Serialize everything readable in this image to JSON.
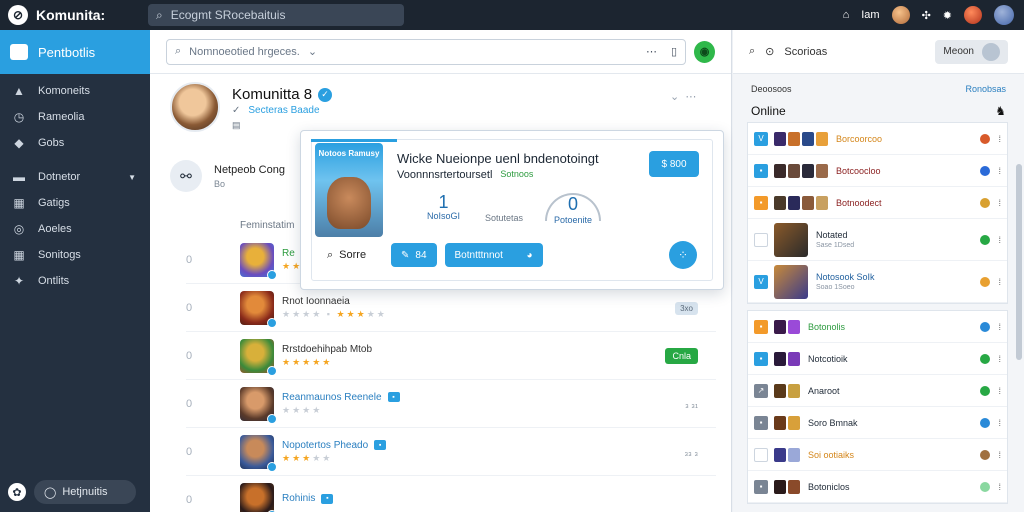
{
  "topbar": {
    "brand": "Komunita:",
    "search_placeholder": "Ecogmt SRocebaituis",
    "user_label": "Iam"
  },
  "leftnav": {
    "active": "Pentbotlis",
    "items": [
      {
        "icon": "person-icon",
        "glyph": "▲",
        "label": "Komoneits"
      },
      {
        "icon": "clock-icon",
        "glyph": "◷",
        "label": "Rameolia"
      },
      {
        "icon": "tag-icon",
        "glyph": "◆",
        "label": "Gobs"
      }
    ],
    "items2": [
      {
        "icon": "menu-icon",
        "glyph": "▬",
        "label": "Dotnetor",
        "caret": true
      },
      {
        "icon": "calendar-icon",
        "glyph": "▦",
        "label": "Gatigs"
      },
      {
        "icon": "bubble-icon",
        "glyph": "◎",
        "label": "Aoeles"
      },
      {
        "icon": "grid-icon",
        "glyph": "▦",
        "label": "Sonitogs"
      },
      {
        "icon": "pin-icon",
        "glyph": "✦",
        "label": "Ontlits"
      }
    ],
    "bottom_search": "Hetjnuitis"
  },
  "main": {
    "search_placeholder": "Nomnoeotied hrgeces.",
    "profile": {
      "name": "Komunitta 8",
      "sub_blue": "Secteras Baade",
      "sub_meta": "▤"
    },
    "sub_header": {
      "title": "Netpeob Cong",
      "sub": "Bo"
    },
    "section_label": "Feminstatim",
    "rows": [
      {
        "idx": "0",
        "title": "Re",
        "title_color": "green",
        "stars_on": 3,
        "stars_off": 2,
        "right": "",
        "right_type": "none",
        "colors": [
          "#6a4cbf",
          "#e8b03a",
          "#3e7bd8"
        ]
      },
      {
        "idx": "0",
        "title": "Rnot Ioonnaeia",
        "title_color": "dark",
        "stars_on": 0,
        "stars_off": 4,
        "extra_stars_on": 3,
        "right": "3xo",
        "right_type": "gray",
        "colors": [
          "#8a2a1a",
          "#e28a3a",
          "#3a1a10"
        ]
      },
      {
        "idx": "0",
        "title": "Rrstdoehihpab Mtob",
        "title_color": "dark",
        "stars_on": 5,
        "stars_off": 0,
        "right": "Cnla",
        "right_type": "green",
        "colors": [
          "#3a8a3a",
          "#d8b03a",
          "#b5472a"
        ]
      },
      {
        "idx": "0",
        "title": "Reanmaunos Reenele",
        "title_color": "blue",
        "stars_on": 0,
        "stars_off": 4,
        "right": "₃ ₃₁",
        "right_type": "text",
        "colors": [
          "#5a3a2a",
          "#d89a6a",
          "#2a2a3a"
        ]
      },
      {
        "idx": "0",
        "title": "Nopotertos Pheado",
        "title_color": "blue",
        "stars_on": 3,
        "stars_off": 2,
        "right": "₃₃ ₃",
        "right_type": "text",
        "colors": [
          "#3a5a9a",
          "#c88a5a",
          "#1a2a4a"
        ]
      },
      {
        "idx": "0",
        "title": "Rohinis",
        "title_color": "blue",
        "stars_on": 0,
        "stars_off": 0,
        "right": "",
        "right_type": "none",
        "colors": [
          "#2a1a1a",
          "#c8702a",
          "#5a3a1a"
        ]
      }
    ]
  },
  "popup": {
    "card_label": "Notoos Ramusy",
    "title": "Wicke Nueionpe uenl bndenotoingt",
    "subtitle": "Voonnnsrtertoursetl",
    "subtitle_green": "Sotnoos",
    "price_btn": "$ 800",
    "stat1_num": "1",
    "stat1_lbl": "NoIsoGI",
    "stat1_lbl2": "Sotutetas",
    "stat2_num": "0",
    "stat2_lbl": "Potoenite",
    "search_label": "Sorre",
    "btn1": "84",
    "btn2": "Botntttnnot",
    "fab": "⁘"
  },
  "right": {
    "top_label": "Scorioas",
    "top_btn": "Meoon",
    "section_left": "Deoosoos",
    "section_right": "Ronobsas",
    "online_label": "Online",
    "rows": [
      {
        "sq": "blue",
        "sq_glyph": "V",
        "kind": "thumbs",
        "name": "Borcoorcoo",
        "name_color": "orange",
        "thumbs": [
          "#3a2a6a",
          "#c8702a",
          "#2a4a8a",
          "#e8a03a"
        ],
        "status": "#d85a2a"
      },
      {
        "sq": "blue",
        "sq_glyph": "▪",
        "kind": "thumbs",
        "name": "Botcoocloo",
        "name_color": "dark",
        "thumbs": [
          "#3a2a2a",
          "#6a4a3a",
          "#2a2a3a",
          "#9a6a4a"
        ],
        "status": "#2a6ad8"
      },
      {
        "sq": "orange",
        "sq_glyph": "▪",
        "kind": "thumbs",
        "name": "Botnoodect",
        "name_color": "dark",
        "thumbs": [
          "#4a3a2a",
          "#2a2a5a",
          "#8a5a3a",
          "#c8a060"
        ],
        "status": "#d8a030"
      },
      {
        "sq": "white",
        "sq_glyph": "",
        "kind": "big",
        "name": "Notated",
        "name_color": "plain",
        "small": "Sase 1Dsed",
        "thumbs": [
          "#8a5a2a",
          "#2a2a2a"
        ],
        "status": "#27a844",
        "tall": true
      },
      {
        "sq": "blue",
        "sq_glyph": "V",
        "kind": "big",
        "name": "Notosook SoIk",
        "name_color": "blue",
        "small": "Soao 1Soeo",
        "thumbs": [
          "#c88a3a",
          "#3a3a8a"
        ],
        "status": "#e8a030",
        "tall": true
      }
    ],
    "rows2": [
      {
        "sq": "orange",
        "sq_glyph": "▪",
        "name": "Botonolis",
        "name_color": "green",
        "thumbs": [
          "#3a1a4a",
          "#9a4ad8"
        ],
        "status": "#2a8ad8"
      },
      {
        "sq": "blue",
        "sq_glyph": "▪",
        "name": "Notcotioik",
        "name_color": "plain",
        "thumbs": [
          "#2a1a3a",
          "#7a3ab8"
        ],
        "status": "#27a844"
      },
      {
        "sq": "gray",
        "sq_glyph": "↗",
        "name": "Anaroot",
        "name_color": "plain",
        "thumbs": [
          "#5a3a1a",
          "#c8a040"
        ],
        "status": "#27a844"
      },
      {
        "sq": "gray",
        "sq_glyph": "▪",
        "name": "Soro Bmnak",
        "name_color": "plain",
        "thumbs": [
          "#6a3a1a",
          "#d8a03a"
        ],
        "status": "#2a8ad8"
      },
      {
        "sq": "white",
        "sq_glyph": "",
        "name": "Soi ootiaiks",
        "name_color": "orange",
        "thumbs": [
          "#3a3a8a",
          "#9aa8d8"
        ],
        "status": "#a07040"
      },
      {
        "sq": "gray",
        "sq_glyph": "▪",
        "name": "Botoniclos",
        "name_color": "plain",
        "thumbs": [
          "#2a1a1a",
          "#8a4a2a"
        ],
        "status": "#8ad8a0"
      }
    ]
  }
}
